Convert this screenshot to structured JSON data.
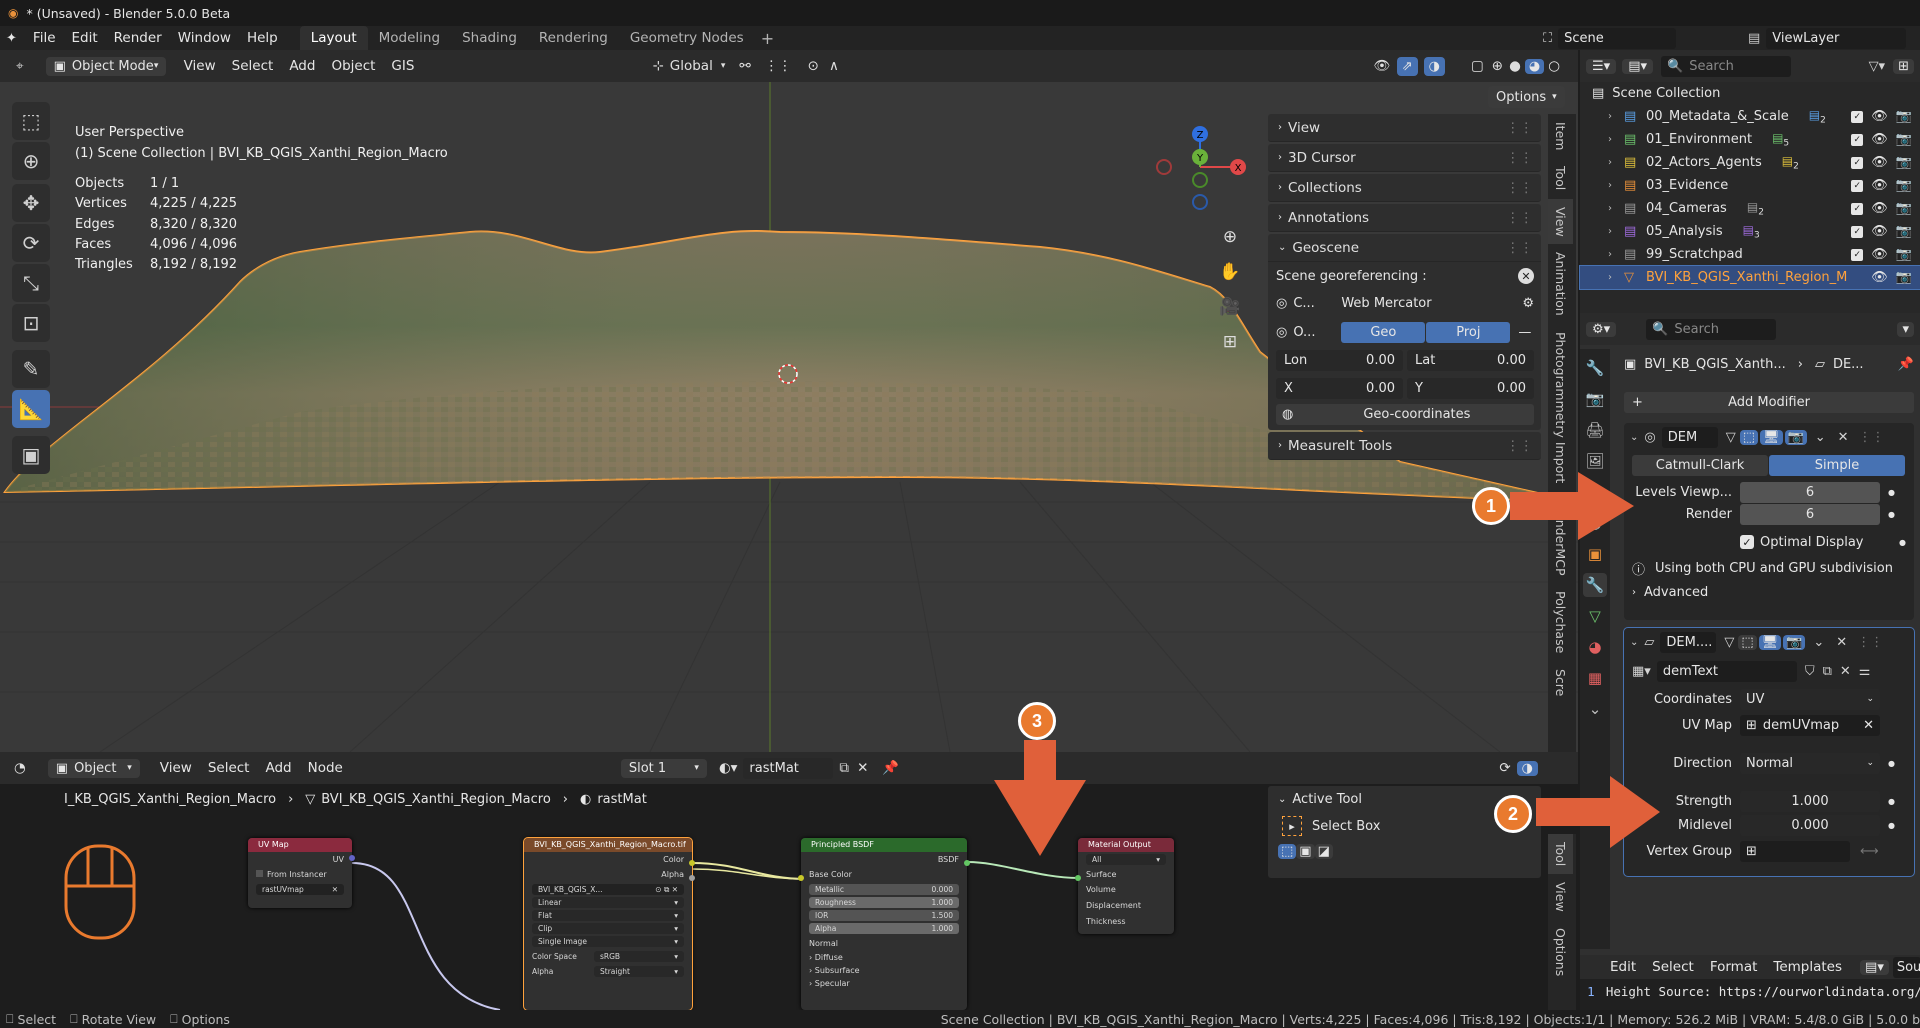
{
  "app": {
    "title": "* (Unsaved) - Blender 5.0.0 Beta"
  },
  "menu": {
    "items": [
      "File",
      "Edit",
      "Render",
      "Window",
      "Help"
    ],
    "workspaces": [
      "Layout",
      "Modeling",
      "Shading",
      "Rendering",
      "Geometry Nodes"
    ],
    "scene": "Scene",
    "view_layer": "ViewLayer"
  },
  "viewport": {
    "mode": "Object Mode",
    "menus": [
      "View",
      "Select",
      "Add",
      "Object",
      "GIS"
    ],
    "orientation": "Global",
    "options": "Options",
    "overlay_title": "User Perspective",
    "overlay_sub": "(1) Scene Collection | BVI_KB_QGIS_Xanthi_Region_Macro",
    "stats": [
      {
        "label": "Objects",
        "value": "1 / 1"
      },
      {
        "label": "Vertices",
        "value": "4,225 / 4,225"
      },
      {
        "label": "Edges",
        "value": "8,320 / 8,320"
      },
      {
        "label": "Faces",
        "value": "4,096 / 4,096"
      },
      {
        "label": "Triangles",
        "value": "8,192 / 8,192"
      }
    ],
    "gizmo": {
      "z": "Z",
      "y": "Y",
      "x": "X"
    }
  },
  "npanel": {
    "sections": [
      "View",
      "3D Cursor",
      "Collections",
      "Annotations"
    ],
    "geoscene": "Geoscene",
    "georef_label": "Scene georeferencing :",
    "crs_short": "C...",
    "crs_value": "Web Mercator",
    "origin_short": "O...",
    "geo_btn": "Geo",
    "proj_btn": "Proj",
    "lon_label": "Lon",
    "lon_value": "0.00",
    "lat_label": "Lat",
    "lat_value": "0.00",
    "x_label": "X",
    "x_value": "0.00",
    "y_label": "Y",
    "y_value": "0.00",
    "geocoord_btn": "Geo-coordinates",
    "measureit": "MeasureIt Tools",
    "tabs": [
      "Item",
      "Tool",
      "View",
      "Animation",
      "Photogrammetry Import",
      "BlenderMCP",
      "Polychase",
      "Scre"
    ]
  },
  "outliner": {
    "search_placeholder": "Search",
    "root": "Scene Collection",
    "items": [
      {
        "name": "00_Metadata_&_Scale",
        "badge": "2",
        "color": "#5aa0e6"
      },
      {
        "name": "01_Environment",
        "badge": "5",
        "color": "#6cc26c"
      },
      {
        "name": "02_Actors_Agents",
        "badge": "2",
        "color": "#e0c23c"
      },
      {
        "name": "03_Evidence",
        "badge": "",
        "color": "#e9913a"
      },
      {
        "name": "04_Cameras",
        "badge": "2",
        "color": "#9a9a9a"
      },
      {
        "name": "05_Analysis",
        "badge": "3",
        "color": "#a06ce0"
      },
      {
        "name": "99_Scratchpad",
        "badge": "",
        "color": "#9a9a9a"
      },
      {
        "name": "BVI_KB_QGIS_Xanthi_Region_M",
        "badge": "",
        "color": "#e9913a"
      }
    ]
  },
  "properties": {
    "search_placeholder": "Search",
    "breadcrumb_obj": "BVI_KB_QGIS_Xanth...",
    "breadcrumb_mod": "DE...",
    "add_modifier": "Add Modifier",
    "mod1": {
      "name": "DEM",
      "catmull": "Catmull-Clark",
      "simple": "Simple",
      "levels_label": "Levels Viewp...",
      "levels_value": "6",
      "render_label": "Render",
      "render_value": "6",
      "optimal": "Optimal Display",
      "info": "Using both CPU and GPU subdivision",
      "advanced": "Advanced"
    },
    "mod2": {
      "name": "DEM....",
      "texture": "demText",
      "coords_label": "Coordinates",
      "coords_value": "UV",
      "uvmap_label": "UV Map",
      "uvmap_value": "demUVmap",
      "direction_label": "Direction",
      "direction_value": "Normal",
      "strength_label": "Strength",
      "strength_value": "1.000",
      "midlevel_label": "Midlevel",
      "midlevel_value": "0.000",
      "vgroup_label": "Vertex Group"
    }
  },
  "node_editor": {
    "mode": "Object",
    "menus": [
      "View",
      "Select",
      "Add",
      "Node"
    ],
    "slot": "Slot 1",
    "material": "rastMat",
    "breadcrumb": [
      "I_KB_QGIS_Xanthi_Region_Macro",
      "BVI_KB_QGIS_Xanthi_Region_Macro",
      "rastMat"
    ],
    "active_tool": "Active Tool",
    "select_box": "Select Box",
    "tabs": [
      "Tool",
      "View",
      "Options"
    ],
    "uvnode": {
      "title": "UV Map",
      "out": "UV",
      "from_instancer": "From Instancer",
      "map": "rastUVmap"
    },
    "texnode": {
      "title": "BVI_KB_QGIS_Xanthi_Region_Macro.tif",
      "color": "Color",
      "alpha": "Alpha",
      "img": "BVI_KB_QGIS_X...",
      "interp": "Linear",
      "proj": "Flat",
      "ext": "Clip",
      "src": "Single Image",
      "cs_label": "Color Space",
      "cs_value": "sRGB",
      "alpha_label": "Alpha",
      "alpha_value": "Straight"
    },
    "bsdf": {
      "title": "Principled BSDF",
      "out": "BSDF",
      "base": "Base Color",
      "metallic": "Metallic",
      "metallic_v": "0.000",
      "rough": "Roughness",
      "rough_v": "1.000",
      "ior": "IOR",
      "ior_v": "1.500",
      "alpha": "Alpha",
      "alpha_v": "1.000",
      "normal": "Normal",
      "diffuse": "Diffuse",
      "subsurface": "Subsurface",
      "specular": "Specular"
    },
    "output": {
      "title": "Material Output",
      "target": "All",
      "surface": "Surface",
      "volume": "Volume",
      "displacement": "Displacement",
      "thickness": "Thickness"
    }
  },
  "text_editor": {
    "menus": [
      "Edit",
      "Select",
      "Format",
      "Templates"
    ],
    "line_no": "1",
    "line": "Height Source: https://ourworldindata.org/",
    "extra": "Sou"
  },
  "callouts": [
    "1",
    "2",
    "3"
  ],
  "status": {
    "left": [
      "Select",
      "Rotate View",
      "Options"
    ],
    "right": "Scene Collection | BVI_KB_QGIS_Xanthi_Region_Macro | Verts:4,225 | Faces:4,096 | Tris:8,192 | Objects:1/1 | Memory: 526.2 MiB | VRAM: 5.4/8.0 GiB | 5.0.0 b"
  },
  "colors": {
    "accent": "#4772b3",
    "callout": "#e97a2e",
    "selection": "#ffa23c"
  }
}
